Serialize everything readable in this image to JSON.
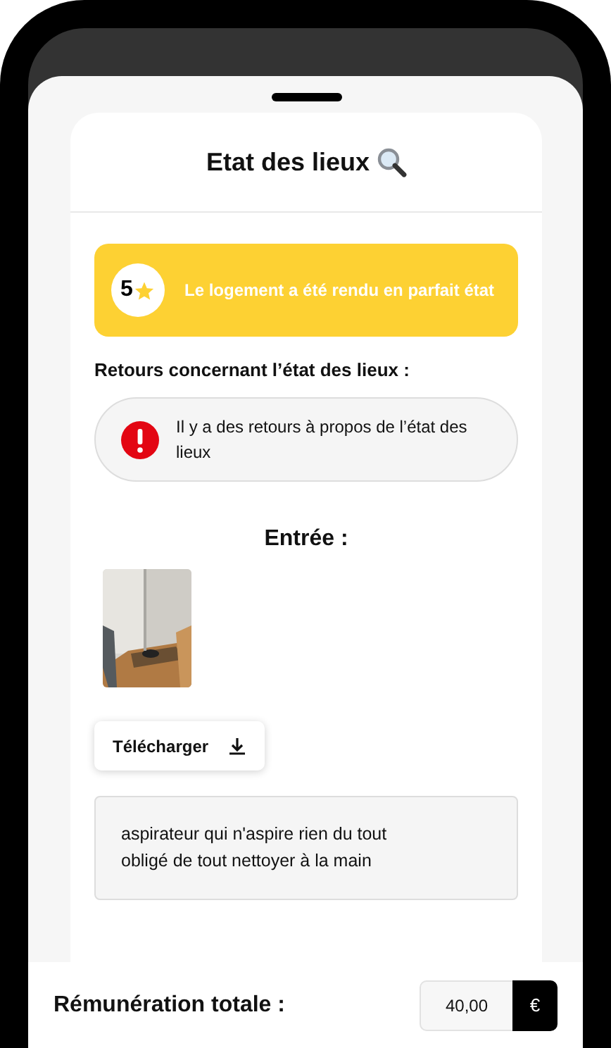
{
  "sheet": {
    "title": "Etat des lieux",
    "rating": {
      "score": "5",
      "message": "Le logement a été rendu en parfait état"
    },
    "feedback_label": "Retours concernant l’état des lieux :",
    "feedback_alert": "Il y a des retours à propos de l’état des lieux",
    "entry_title": "Entrée :",
    "download_button": "Télécharger",
    "comment": [
      "aspirateur qui n'aspire rien du tout",
      "obligé de tout nettoyer à la main"
    ]
  },
  "footer": {
    "label": "Rémunération totale :",
    "amount": "40,00",
    "currency": "€"
  }
}
